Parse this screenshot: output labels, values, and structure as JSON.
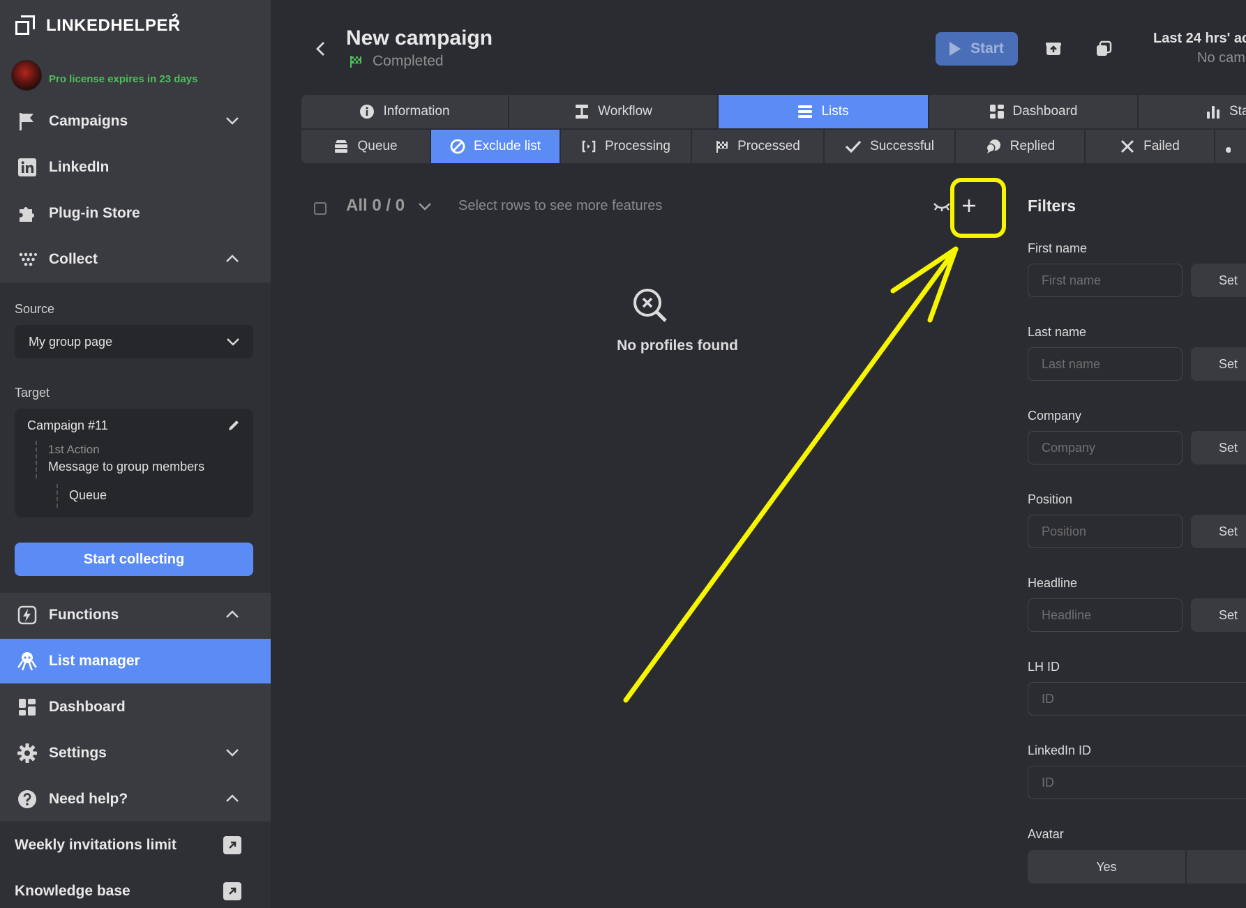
{
  "app": {
    "logo_text": "LINKEDHELPER",
    "logo_sup": "2",
    "license_text": "Pro license expires in 23 days"
  },
  "sidebar": {
    "nav": [
      {
        "label": "Campaigns",
        "icon": "flag-icon"
      },
      {
        "label": "LinkedIn",
        "icon": "linkedin-icon"
      },
      {
        "label": "Plug-in Store",
        "icon": "puzzle-icon"
      },
      {
        "label": "Collect",
        "icon": "dots-icon"
      }
    ],
    "collect": {
      "source_label": "Source",
      "source_value": "My group page",
      "target_label": "Target",
      "target_campaign": "Campaign #11",
      "target_action_num": "1st Action",
      "target_action": "Message to group members",
      "target_list": "Queue",
      "start_button": "Start collecting"
    },
    "nav2": [
      {
        "label": "Functions",
        "icon": "bolt-icon"
      },
      {
        "label": "List manager",
        "icon": "octopus-icon"
      },
      {
        "label": "Dashboard",
        "icon": "grid-icon"
      },
      {
        "label": "Settings",
        "icon": "gear-icon"
      },
      {
        "label": "Need help?",
        "icon": "question-icon"
      }
    ],
    "links": [
      {
        "label": "Weekly invitations limit"
      },
      {
        "label": "Knowledge base"
      }
    ]
  },
  "header": {
    "title": "New campaign",
    "status": "Completed",
    "start_label": "Start",
    "last24": "Last 24 hrs' ac",
    "nocamp": "No cam"
  },
  "tabs": [
    {
      "label": "Information",
      "icon": "info-icon"
    },
    {
      "label": "Workflow",
      "icon": "workflow-icon"
    },
    {
      "label": "Lists",
      "icon": "list-icon"
    },
    {
      "label": "Dashboard",
      "icon": "grid-icon"
    },
    {
      "label": "Sta",
      "icon": "bar-chart-icon"
    }
  ],
  "subtabs": [
    {
      "label": "Queue",
      "icon": "stack-icon"
    },
    {
      "label": "Exclude list",
      "icon": "ban-icon"
    },
    {
      "label": "Processing",
      "icon": "refresh-icon"
    },
    {
      "label": "Processed",
      "icon": "flag-icon"
    },
    {
      "label": "Successful",
      "icon": "check-icon"
    },
    {
      "label": "Replied",
      "icon": "chat-icon"
    },
    {
      "label": "Failed",
      "icon": "x-icon"
    }
  ],
  "toolbar": {
    "all_label": "All 0 / 0",
    "hint": "Select rows to see more features"
  },
  "empty": {
    "text": "No profiles found"
  },
  "filters": {
    "title": "Filters",
    "set_label": "Set",
    "fields": [
      {
        "label": "First name",
        "placeholder": "First name"
      },
      {
        "label": "Last name",
        "placeholder": "Last name"
      },
      {
        "label": "Company",
        "placeholder": "Company"
      },
      {
        "label": "Position",
        "placeholder": "Position"
      },
      {
        "label": "Headline",
        "placeholder": "Headline"
      },
      {
        "label": "LH ID",
        "placeholder": "ID"
      },
      {
        "label": "LinkedIn ID",
        "placeholder": "ID"
      },
      {
        "label": "Avatar"
      }
    ],
    "avatar_yes": "Yes"
  },
  "colors": {
    "accent": "#5b8cf5",
    "annotation": "#f7f500",
    "license_green": "#4fbf5a"
  }
}
